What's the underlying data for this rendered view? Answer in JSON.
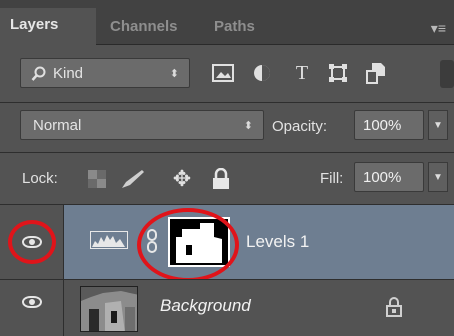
{
  "tabs": [
    {
      "label": "Layers",
      "active": true
    },
    {
      "label": "Channels",
      "active": false
    },
    {
      "label": "Paths",
      "active": false
    }
  ],
  "filter": {
    "kind_label": "Kind",
    "icons": [
      "image-filter-icon",
      "adjustment-filter-icon",
      "type-filter-icon",
      "shape-filter-icon",
      "smart-object-filter-icon"
    ]
  },
  "blend": {
    "mode": "Normal",
    "opacity_label": "Opacity:",
    "opacity_value": "100%"
  },
  "lock": {
    "label": "Lock:",
    "fill_label": "Fill:",
    "fill_value": "100%"
  },
  "layers": [
    {
      "name": "Levels 1",
      "type": "adjustment",
      "visible": true,
      "selected": true
    },
    {
      "name": "Background",
      "type": "image",
      "visible": true,
      "selected": false,
      "locked": true
    }
  ],
  "colors": {
    "panel_bg": "#535353",
    "selected_row": "#6e7e91",
    "highlight_ring": "#e0141a"
  }
}
